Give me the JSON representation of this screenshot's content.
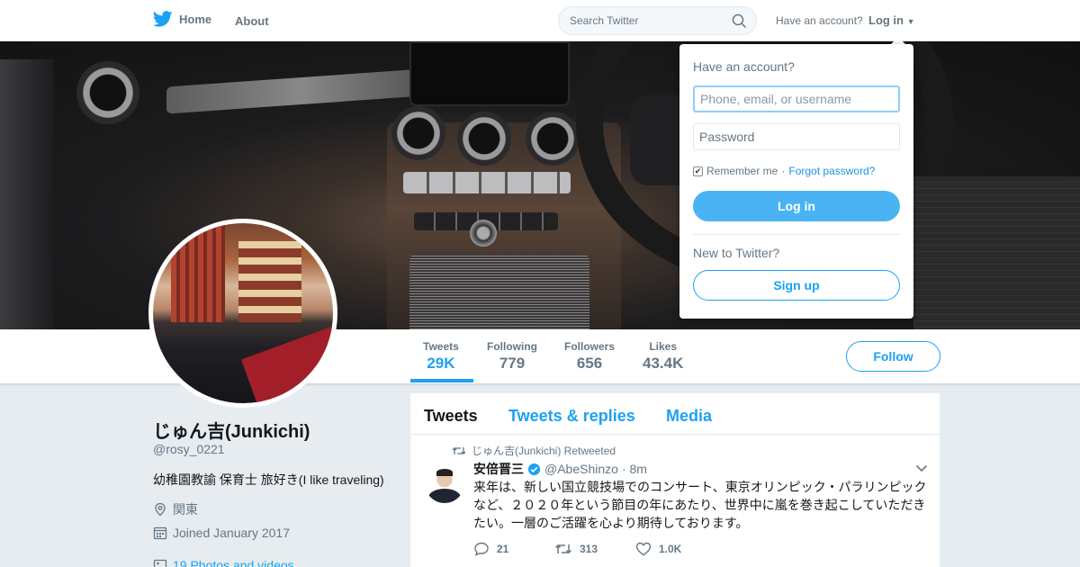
{
  "nav": {
    "home_label": "Home",
    "about_label": "About",
    "search_placeholder": "Search Twitter",
    "have_account": "Have an account?",
    "login_label": "Log in"
  },
  "login_dropdown": {
    "title": "Have an account?",
    "username_placeholder": "Phone, email, or username",
    "password_placeholder": "Password",
    "remember_label": "Remember me",
    "separator": "·",
    "forgot_label": "Forgot password?",
    "login_button": "Log in",
    "new_label": "New to Twitter?",
    "signup_button": "Sign up"
  },
  "stats": [
    {
      "label": "Tweets",
      "value": "29K"
    },
    {
      "label": "Following",
      "value": "779"
    },
    {
      "label": "Followers",
      "value": "656"
    },
    {
      "label": "Likes",
      "value": "43.4K"
    }
  ],
  "follow_button": "Follow",
  "profile": {
    "name": "じゅん吉(Junkichi)",
    "handle": "@rosy_0221",
    "bio": "幼稚園教諭 保育士 旅好き(I like traveling)",
    "location": "関東",
    "joined": "Joined January 2017",
    "media": "19 Photos and videos"
  },
  "timeline": {
    "tabs": [
      "Tweets",
      "Tweets & replies",
      "Media"
    ],
    "tweet": {
      "retweeted_by": "じゅん吉(Junkichi) Retweeted",
      "name": "安倍晋三",
      "handle": "@AbeShinzo",
      "time": "· 8m",
      "text": "来年は、新しい国立競技場でのコンサート、東京オリンピック・パラリンピックなど、２０２０年という節目の年にあたり、世界中に嵐を巻き起こしていただきたい。一層のご活躍を心より期待しております。",
      "replies": "21",
      "retweets": "313",
      "likes": "1.0K"
    }
  },
  "colors": {
    "accent": "#1da1f2",
    "login_button": "#4ab3f4",
    "text_secondary": "#657786",
    "background": "#e6ecf0"
  }
}
